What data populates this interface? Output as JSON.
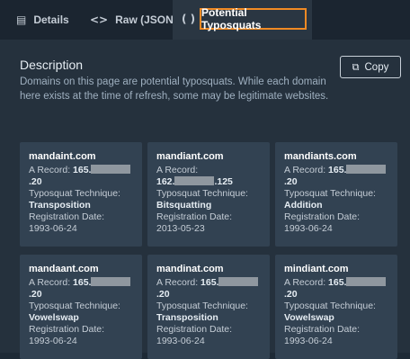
{
  "tabs": [
    {
      "label": "Details",
      "icon": "document-icon"
    },
    {
      "label": "Raw (JSON)",
      "icon": "code-icon"
    },
    {
      "label": "Potential Typosquats",
      "icon": "parentheses-icon"
    }
  ],
  "section": {
    "title": "Description",
    "description": "Domains on this page are potential typosquats. While each domain here exists at the time of refresh, some may be legitimate websites.",
    "copy_label": "Copy"
  },
  "labels": {
    "a_record": "A Record:",
    "technique": "Typosquat Technique:",
    "reg_date": "Registration Date:"
  },
  "cards": [
    {
      "domain": "mandaint.com",
      "ip_prefix": "165.",
      "ip_suffix": ".20",
      "technique": "Transposition",
      "date": "1993-06-24"
    },
    {
      "domain": "mandiant.com",
      "ip_prefix": "162.",
      "ip_suffix": ".125",
      "technique": "Bitsquatting",
      "date": "2013-05-23"
    },
    {
      "domain": "mandiants.com",
      "ip_prefix": "165.",
      "ip_suffix": ".20",
      "technique": "Addition",
      "date": "1993-06-24"
    },
    {
      "domain": "mandaant.com",
      "ip_prefix": "165.",
      "ip_suffix": ".20",
      "technique": "Vowelswap",
      "date": "1993-06-24"
    },
    {
      "domain": "mandinat.com",
      "ip_prefix": "165.",
      "ip_suffix": ".20",
      "technique": "Transposition",
      "date": "1993-06-24"
    },
    {
      "domain": "mindiant.com",
      "ip_prefix": "165.",
      "ip_suffix": ".20",
      "technique": "Vowelswap",
      "date": "1993-06-24"
    }
  ]
}
